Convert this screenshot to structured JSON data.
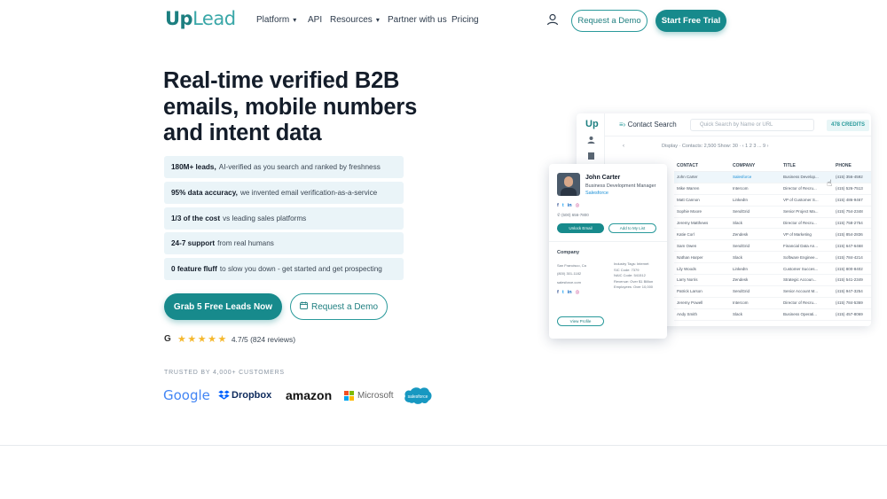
{
  "nav": {
    "logo_up": "Up",
    "logo_lead": "Lead",
    "links": [
      "Platform",
      "API",
      "Resources",
      "Partner with us",
      "Pricing"
    ],
    "request_demo": "Request a Demo",
    "start_trial": "Start Free Trial"
  },
  "hero": {
    "title": "Real-time verified B2B emails, mobile numbers and intent data",
    "features": [
      {
        "bold": "180M+ leads,",
        "rest": "AI-verified as you search and ranked by freshness"
      },
      {
        "bold": "95% data accuracy,",
        "rest": "we invented email verification-as-a-service"
      },
      {
        "bold": "1/3 of the cost",
        "rest": "vs leading sales platforms"
      },
      {
        "bold": "24-7 support",
        "rest": "from real humans"
      },
      {
        "bold": "0 feature fluff",
        "rest": "to slow you down - get started and get prospecting"
      }
    ],
    "cta_primary": "Grab 5 Free Leads Now",
    "cta_secondary": "Request a Demo",
    "rating_text": "4.7/5 (824 reviews)",
    "rating_stars": 5,
    "trusted": "TRUSTED BY 4,000+ CUSTOMERS",
    "logos": [
      "Google",
      "Dropbox",
      "amazon",
      "Microsoft",
      "salesforce"
    ]
  },
  "app": {
    "logo": "Up",
    "title": "Contact Search",
    "search_placeholder": "Quick Search by Name or URL",
    "credits": "478 CREDITS",
    "toolbar": "Display · Contacts: 2,500   Show: 30 ·   ‹ 1 2 3 ... 9 ›",
    "headers": [
      "CONTACT",
      "COMPANY",
      "TITLE",
      "PHONE"
    ],
    "rows": [
      [
        "John Carter",
        "Salesforce",
        "Business Develop...",
        "(415) 356-4592"
      ],
      [
        "Mike Warren",
        "Intercom",
        "Director of Recru...",
        "(415) 526-7513"
      ],
      [
        "Matt Cannon",
        "LinkedIn",
        "VP of Customer S...",
        "(415) 486-9467"
      ],
      [
        "Sophie Moore",
        "SendGrid",
        "Senior Project Ma...",
        "(415) 754-2348"
      ],
      [
        "Jeremy Matthews",
        "Slack",
        "Director of Recru...",
        "(415) 758-2754"
      ],
      [
        "Katie Corl",
        "Zendesk",
        "VP of Marketing",
        "(415) 854-2836"
      ],
      [
        "Sam Owen",
        "SendGrid",
        "Financial Data An...",
        "(415) 647-6468"
      ],
      [
        "Nathan Harper",
        "Slack",
        "Software Enginee...",
        "(415) 784-4214"
      ],
      [
        "Lily Woods",
        "LinkedIn",
        "Customer Succes...",
        "(415) 800-8402"
      ],
      [
        "Larry Norris",
        "Zendesk",
        "Strategic Accoun...",
        "(415) 541-2349"
      ],
      [
        "Patrick Larson",
        "SendGrid",
        "Senior Account M...",
        "(415) 947-3254"
      ],
      [
        "Jeremy Powell",
        "Intercom",
        "Director of Recru...",
        "(415) 784-5369"
      ],
      [
        "Andy Smith",
        "Slack",
        "Business Operati...",
        "(415) 457-8069"
      ]
    ]
  },
  "card": {
    "name": "John Carter",
    "role": "Business Development Manager",
    "company": "Salesforce",
    "socials": [
      "f",
      "t",
      "in",
      "◎"
    ],
    "phone": "(500) 656-7800",
    "unlock": "Unlock Email",
    "add_list": "Add to My List",
    "company_label": "Company",
    "co_left": [
      "San Francisco, Ca",
      "(800) 301-1182",
      "salesforce.com"
    ],
    "co_right": [
      "Industry Tags: Internet",
      "SIC Code: 7379",
      "NAIC Code: 541512",
      "Revenue: Over $1 Billion",
      "Employees: Over 10,000"
    ],
    "view_profile": "View Profile"
  }
}
